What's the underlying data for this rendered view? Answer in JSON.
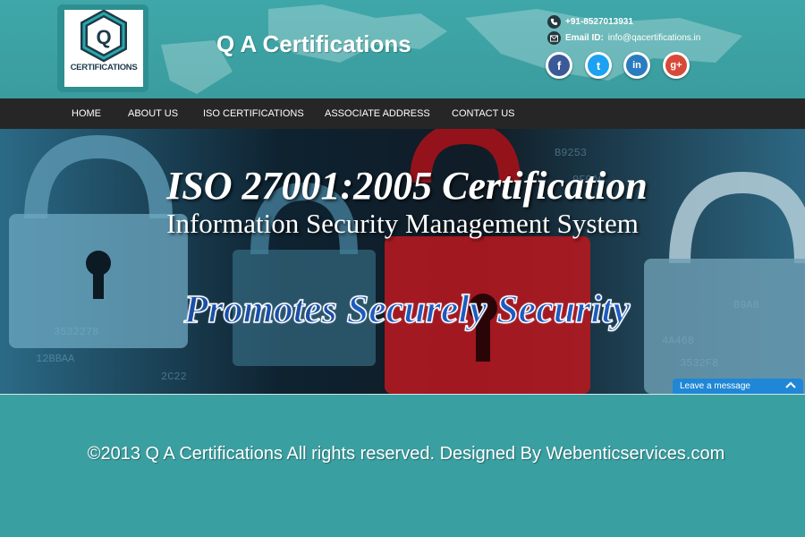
{
  "header": {
    "logo_text": "CERTIFICATIONS",
    "site_title": "Q A Certifications",
    "phone": "+91-8527013931",
    "email_label": "Email ID:",
    "email": "info@qacertifications.in",
    "social": [
      {
        "name": "facebook-icon",
        "glyph": "f"
      },
      {
        "name": "twitter-icon",
        "glyph": "t"
      },
      {
        "name": "linkedin-icon",
        "glyph": "in"
      },
      {
        "name": "google-plus-icon",
        "glyph": "g+"
      }
    ]
  },
  "nav": {
    "items": [
      "HOME",
      "ABOUT US",
      "ISO CERTIFICATIONS",
      "ASSOCIATE ADDRESS",
      "CONTACT US"
    ]
  },
  "hero": {
    "title": "ISO 27001:2005 Certification",
    "subtitle": "Information Security Management System",
    "tag_word1": "Promotes",
    "tag_word2": "Securely Security"
  },
  "chat": {
    "label": "Leave a message"
  },
  "footer": {
    "copyright": "©2013 Q A Certifications All rights reserved. Designed By Webenticservices.com"
  },
  "colors": {
    "teal": "#3a9fa1",
    "nav": "#262626",
    "chat": "#1f87d6"
  }
}
